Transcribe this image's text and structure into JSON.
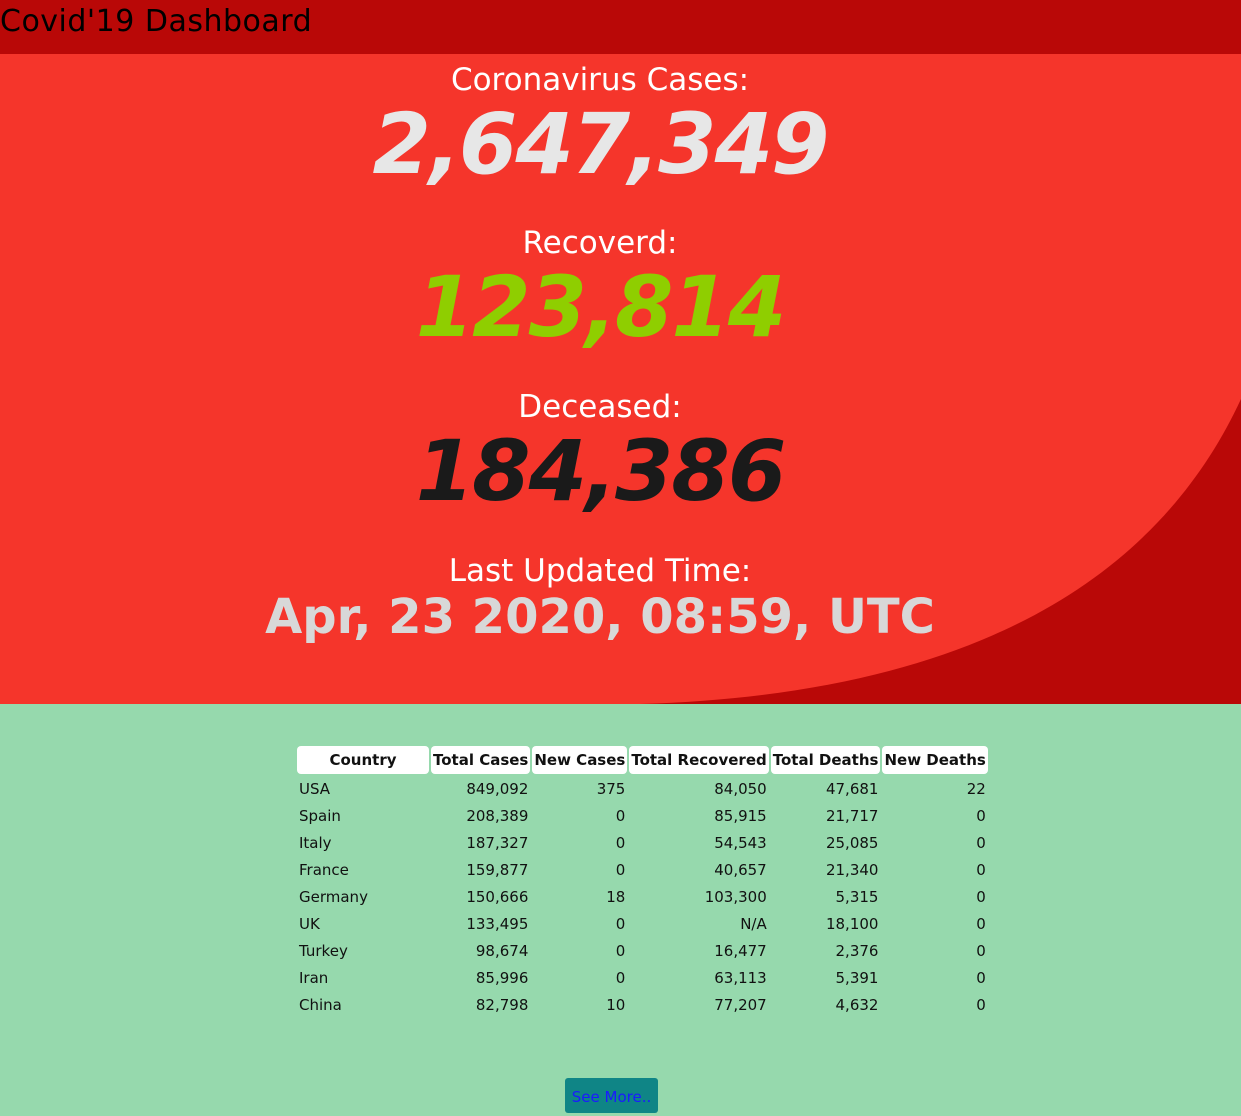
{
  "header": {
    "title": "Covid'19 Dashboard"
  },
  "colors": {
    "header_bg": "#b90807",
    "hero_bg": "#f5352b",
    "hero_curve": "#b90807",
    "page_bg": "#96d9ad",
    "recovered": "#8fce00",
    "deceased": "#1a1a1a",
    "button_bg": "#0f8586"
  },
  "stats": {
    "cases_label": "Coronavirus Cases:",
    "cases_value": "2,647,349",
    "recovered_label": "Recoverd:",
    "recovered_value": "123,814",
    "deceased_label": "Deceased:",
    "deceased_value": "184,386",
    "updated_label": "Last Updated Time:",
    "updated_value": "Apr, 23 2020, 08:59, UTC"
  },
  "table": {
    "headers": [
      "Country",
      "Total Cases",
      "New Cases",
      "Total Recovered",
      "Total Deaths",
      "New Deaths"
    ],
    "rows": [
      [
        "USA",
        "849,092",
        "375",
        "84,050",
        "47,681",
        "22"
      ],
      [
        "Spain",
        "208,389",
        "0",
        "85,915",
        "21,717",
        "0"
      ],
      [
        "Italy",
        "187,327",
        "0",
        "54,543",
        "25,085",
        "0"
      ],
      [
        "France",
        "159,877",
        "0",
        "40,657",
        "21,340",
        "0"
      ],
      [
        "Germany",
        "150,666",
        "18",
        "103,300",
        "5,315",
        "0"
      ],
      [
        "UK",
        "133,495",
        "0",
        "N/A",
        "18,100",
        "0"
      ],
      [
        "Turkey",
        "98,674",
        "0",
        "16,477",
        "2,376",
        "0"
      ],
      [
        "Iran",
        "85,996",
        "0",
        "63,113",
        "5,391",
        "0"
      ],
      [
        "China",
        "82,798",
        "10",
        "77,207",
        "4,632",
        "0"
      ]
    ]
  },
  "see_more": {
    "label": "See More.."
  }
}
